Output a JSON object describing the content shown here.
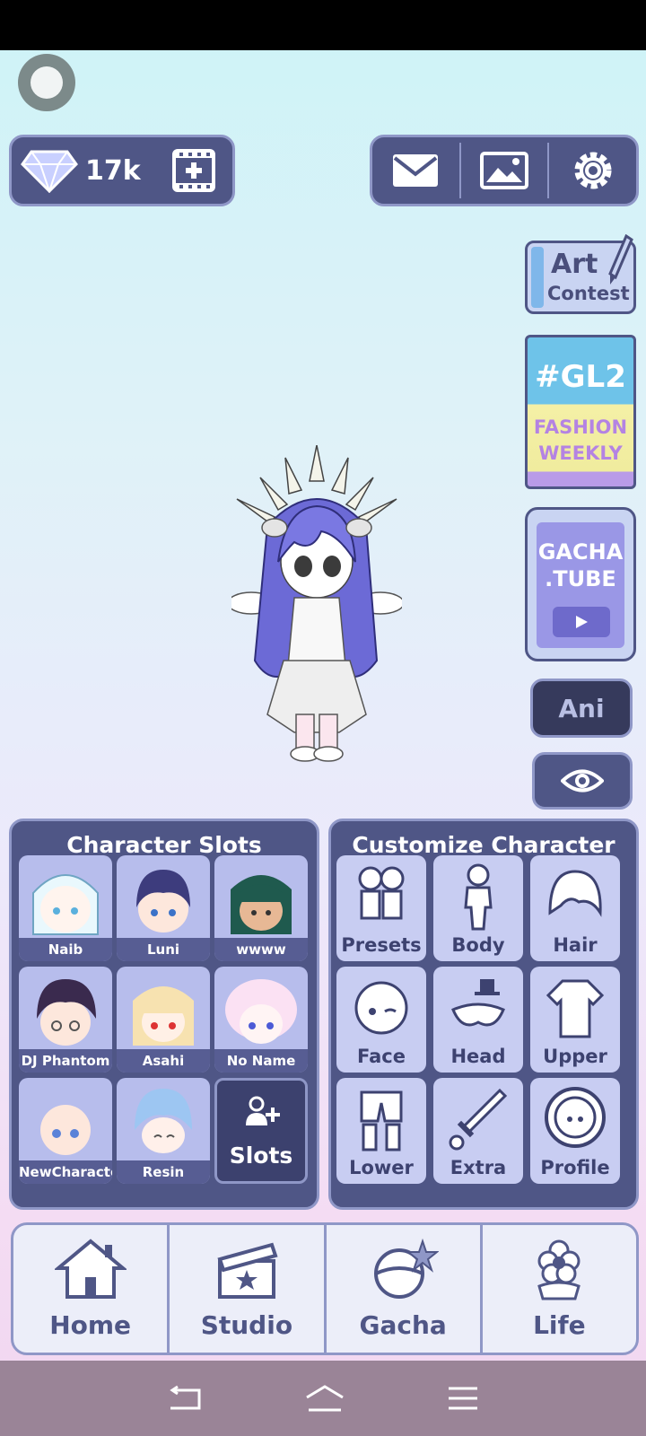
{
  "currency": {
    "gems": "17k"
  },
  "side": {
    "art_contest": [
      "Art",
      "Contest"
    ],
    "gl2": {
      "tag": "#GL2",
      "line1": "FASHION",
      "line2": "WEEKLY"
    },
    "gacha_tube": [
      "GACHA",
      ".TUBE"
    ],
    "ani_label": "Ani"
  },
  "slots": {
    "title": "Character Slots",
    "items": [
      {
        "name": "Naib"
      },
      {
        "name": "Luni"
      },
      {
        "name": "wwww"
      },
      {
        "name": "DJ Phantom"
      },
      {
        "name": "Asahi"
      },
      {
        "name": "No Name"
      },
      {
        "name": "NewCharacter"
      },
      {
        "name": "Resin"
      }
    ],
    "add_label": "Slots"
  },
  "customize": {
    "title": "Customize Character",
    "items": [
      "Presets",
      "Body",
      "Hair",
      "Face",
      "Head",
      "Upper",
      "Lower",
      "Extra",
      "Profile"
    ]
  },
  "nav": {
    "items": [
      "Home",
      "Studio",
      "Gacha",
      "Life"
    ]
  },
  "colors": {
    "panel": "#4f5686",
    "accent": "#8f97c7",
    "button": "#c8cdf2"
  }
}
